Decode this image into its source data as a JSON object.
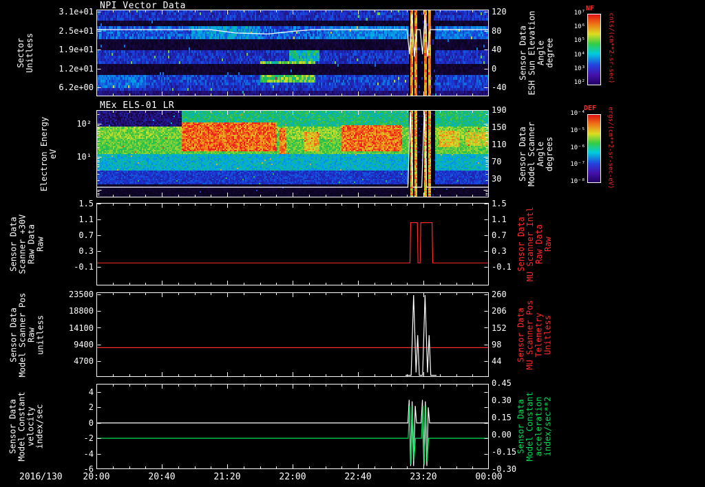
{
  "window": {
    "background": "#000000"
  },
  "date_label": "2016/130",
  "colors": {
    "red": "#ff2a2a",
    "green": "#00dd55",
    "white": "#ffffff"
  },
  "x_axis": {
    "tick_labels": [
      "20:00",
      "20:40",
      "21:20",
      "22:00",
      "22:40",
      "23:20",
      "00:00"
    ],
    "start_minute": 0,
    "end_minute": 240
  },
  "chart_data": [
    {
      "type": "heatmap",
      "title": "NPI Vector Data",
      "ylabel_lines": [
        "Sector",
        "Unitless"
      ],
      "left_ticks": [
        "3.1e+01",
        "2.5e+01",
        "1.9e+01",
        "1.2e+01",
        "6.2e+00"
      ],
      "right_ticks": [
        "120",
        "80",
        "40",
        "0",
        "-40"
      ],
      "right_label_lines": [
        "Sensor Data",
        "ESH Sun Elevation",
        "Angle",
        "degree"
      ],
      "colorbar": {
        "title": "NF",
        "ticks": [
          "10⁷",
          "10⁶",
          "10⁵",
          "10⁴",
          "10³",
          "10²"
        ],
        "unit": "cnts/(cm**2-sr-sec)"
      },
      "y_tick_values": [
        31,
        24.8,
        18.6,
        12.4,
        6.2
      ],
      "y_range": [
        3.27,
        31.68
      ],
      "seed": 7,
      "base_level": 0.2,
      "row_bands": [
        {
          "s0": 20,
          "s1": 27,
          "gain": 1.3
        },
        {
          "s0": 4,
          "s1": 9,
          "gain": 1.15
        },
        {
          "s0": 0,
          "s1": 2,
          "gain": 0.55
        }
      ],
      "black_bands": [
        [
          8.5,
          11.5
        ],
        [
          17.5,
          20.5
        ],
        [
          26.3,
          27.8
        ]
      ],
      "features": [
        {
          "t0": 58,
          "t1": 100,
          "s0": 17,
          "s1": 26,
          "v": 0.42
        },
        {
          "t0": 100,
          "t1": 134,
          "s0": 5,
          "s1": 13,
          "v": 0.62
        },
        {
          "t0": 118,
          "t1": 136,
          "s0": 13,
          "s1": 20,
          "v": 0.5
        },
        {
          "t0": 0,
          "t1": 30,
          "s0": 3,
          "s1": 8,
          "v": 0.36
        },
        {
          "t0": 140,
          "t1": 190,
          "s0": 21,
          "s1": 26,
          "v": 0.38
        },
        {
          "t0": 208,
          "t1": 240,
          "s0": 21,
          "s1": 26,
          "v": 0.36
        }
      ],
      "event": {
        "t0": 191,
        "t1": 207,
        "bright_cols": [
          193,
          195.5,
          201,
          203.5
        ]
      },
      "overlay": {
        "color": "#ffffff",
        "axis": "right",
        "range": [
          -58.9,
          124.4
        ],
        "points": [
          [
            0,
            82
          ],
          [
            70,
            82
          ],
          [
            85,
            75
          ],
          [
            105,
            73
          ],
          [
            122,
            79
          ],
          [
            132,
            82
          ],
          [
            190,
            82
          ],
          [
            191.5,
            30
          ],
          [
            193,
            115
          ],
          [
            194.5,
            25
          ],
          [
            196,
            82
          ],
          [
            198,
            82
          ],
          [
            199.5,
            30
          ],
          [
            201,
            115
          ],
          [
            202.5,
            25
          ],
          [
            204,
            82
          ],
          [
            206,
            82
          ],
          [
            240,
            82
          ]
        ]
      }
    },
    {
      "type": "heatmap",
      "title": "MEx ELS-01 LR",
      "ylabel_lines": [
        "Electron Energy",
        "eV"
      ],
      "left_ticks": [
        "10²",
        "10¹"
      ],
      "right_ticks": [
        "190",
        "150",
        "110",
        "70",
        "30"
      ],
      "right_label_lines": [
        "Sensor Data",
        "Model Scanner",
        "Angle",
        "degrees"
      ],
      "colorbar": {
        "title": "DEF",
        "ticks": [
          "10⁻⁴",
          "10⁻⁵",
          "10⁻⁶",
          "10⁻⁷",
          "10⁻⁸"
        ],
        "unit": "ergs/(cm**2-sr-sec-eV)"
      },
      "log_range": [
        -0.229,
        2.4167
      ],
      "seed": 13,
      "features": [
        {
          "t0": 52,
          "t1": 110,
          "e0": 14,
          "e1": 110,
          "v": 0.93
        },
        {
          "t0": 112,
          "t1": 116,
          "e0": 12,
          "e1": 75,
          "v": 0.9
        },
        {
          "t0": 127,
          "t1": 136,
          "e0": 15,
          "e1": 55,
          "v": 0.82
        },
        {
          "t0": 150,
          "t1": 187,
          "e0": 14,
          "e1": 95,
          "v": 0.92
        },
        {
          "t0": 210,
          "t1": 222,
          "e0": 20,
          "e1": 60,
          "v": 0.8
        },
        {
          "t0": 226,
          "t1": 240,
          "e0": 22,
          "e1": 55,
          "v": 0.75
        }
      ],
      "event": {
        "t0": 191,
        "t1": 207,
        "bright_cols": [
          193,
          195.5,
          201,
          203.5
        ]
      },
      "overlay": {
        "color": "#ffffff",
        "points_energy": [
          [
            0,
            1.2
          ],
          [
            190.5,
            1.2
          ],
          [
            192,
            230
          ],
          [
            193.5,
            1.2
          ],
          [
            199,
            1.2
          ],
          [
            200.5,
            230
          ],
          [
            202,
            1.2
          ],
          [
            240,
            1.2
          ]
        ]
      }
    },
    {
      "type": "line",
      "ylabel_lines": [
        "Sensor Data",
        "Scanner +30V",
        "Raw Data",
        "Raw"
      ],
      "left_ticks": [
        "1.5",
        "1.1",
        "0.7",
        "0.3",
        "-0.1"
      ],
      "right_ticks": [
        "1.5",
        "1.1",
        "0.7",
        "0.3",
        "-0.1"
      ],
      "right_label_lines": [
        "Sensor Data",
        "MU Scanner Intl",
        "Raw Data",
        "Raw"
      ],
      "right_label_color": "#ff2a2a",
      "y_range": [
        -0.57,
        1.517
      ],
      "y_tick_values": [
        1.5,
        1.1,
        0.7,
        0.3,
        -0.1
      ],
      "series": [
        {
          "name": "mu-scanner-raw",
          "color": "#ff2a2a",
          "points": [
            [
              0,
              0
            ],
            [
              191.8,
              0
            ],
            [
              192.2,
              1.02
            ],
            [
              196.3,
              1.02
            ],
            [
              196.7,
              0
            ],
            [
              198,
              0
            ],
            [
              198.4,
              1.02
            ],
            [
              205.3,
              1.02
            ],
            [
              205.7,
              0
            ],
            [
              240,
              0
            ]
          ]
        }
      ]
    },
    {
      "type": "line",
      "ylabel_lines": [
        "Sensor Data",
        "Model Scanner Pos",
        "Raw",
        "unitless"
      ],
      "left_ticks": [
        "23500",
        "18800",
        "14100",
        "9400",
        "4700"
      ],
      "right_ticks": [
        "260",
        "206",
        "152",
        "98",
        "44"
      ],
      "right_label_lines": [
        "Sensor Data",
        "MU Scanner Pos",
        "Telemetry",
        "Unitless"
      ],
      "right_label_color": "#ff2a2a",
      "y_range": [
        240,
        24080
      ],
      "y_tick_values": [
        23500,
        18800,
        14100,
        9400,
        4700
      ],
      "series": [
        {
          "name": "model-scanner-pos",
          "color": "#ff2a2a",
          "points": [
            [
              0,
              8500
            ],
            [
              240,
              8500
            ]
          ]
        },
        {
          "name": "mu-scanner-pos",
          "color": "#ffffff",
          "points": [
            [
              189,
              700
            ],
            [
              192.5,
              700
            ],
            [
              194,
              23300
            ],
            [
              195.5,
              1500
            ],
            [
              196.5,
              12000
            ],
            [
              197.5,
              700
            ],
            [
              199.5,
              700
            ],
            [
              201,
              23300
            ],
            [
              202.5,
              1500
            ],
            [
              203.5,
              12000
            ],
            [
              204.5,
              700
            ],
            [
              208,
              700
            ]
          ]
        }
      ]
    },
    {
      "type": "line",
      "ylabel_lines": [
        "Sensor Data",
        "Model Constant",
        "velocity",
        "index/sec"
      ],
      "left_ticks": [
        "4",
        "2",
        "0",
        "-2",
        "-4",
        "-6"
      ],
      "right_ticks": [
        "0.45",
        "0.30",
        "0.15",
        "0.00",
        "-0.15",
        "-0.30"
      ],
      "right_label_lines": [
        "Sensor Data",
        "Model Constant",
        "acceleration",
        "index/sec**2"
      ],
      "right_label_color": "#00dd55",
      "y_range": [
        -6,
        5.07
      ],
      "y_tick_values": [
        4,
        2,
        0,
        -2,
        -4,
        -6
      ],
      "series": [
        {
          "name": "model-velocity",
          "color": "#ffffff",
          "points": [
            [
              0,
              0
            ],
            [
              190.5,
              0
            ],
            [
              191.3,
              3
            ],
            [
              192.2,
              -5.6
            ],
            [
              193.1,
              2.8
            ],
            [
              194,
              -5.6
            ],
            [
              195,
              2.2
            ],
            [
              195.8,
              0
            ],
            [
              198.6,
              0
            ],
            [
              199.4,
              3
            ],
            [
              200.3,
              -5.6
            ],
            [
              201.2,
              2.8
            ],
            [
              202.1,
              -5.6
            ],
            [
              203,
              2
            ],
            [
              203.8,
              0
            ],
            [
              240,
              0
            ]
          ]
        },
        {
          "name": "model-acceleration",
          "color": "#00dd55",
          "points": [
            [
              0,
              -2
            ],
            [
              190.7,
              -2
            ],
            [
              191.5,
              2.2
            ],
            [
              192.4,
              -5.4
            ],
            [
              193.3,
              2.2
            ],
            [
              194.2,
              -5
            ],
            [
              195.2,
              -2
            ],
            [
              198.8,
              -2
            ],
            [
              199.6,
              2.2
            ],
            [
              200.5,
              -5.4
            ],
            [
              201.4,
              2.2
            ],
            [
              202.3,
              -5
            ],
            [
              203.2,
              -2
            ],
            [
              240,
              -2
            ]
          ]
        }
      ]
    }
  ]
}
